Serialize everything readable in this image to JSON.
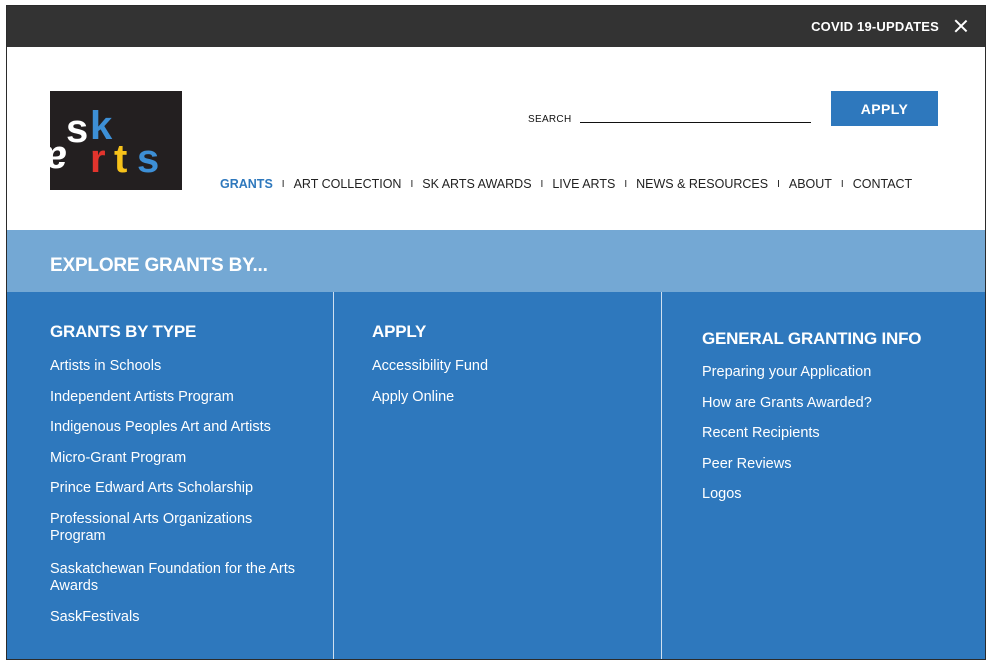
{
  "topbar": {
    "covid_label": "COVID 19-UPDATES"
  },
  "logo": {
    "row1": [
      "s",
      "k"
    ],
    "row2": [
      "a",
      "r",
      "t",
      "s"
    ],
    "colors": {
      "s1": "#ffffff",
      "k": "#3d8fd6",
      "a": "#ffffff",
      "r": "#e2342d",
      "t": "#f7c21a",
      "s2": "#3d8fd6"
    }
  },
  "search": {
    "label": "SEARCH",
    "value": "",
    "placeholder": ""
  },
  "apply_label": "APPLY",
  "nav": {
    "items": [
      {
        "label": "GRANTS",
        "active": true
      },
      {
        "label": "ART COLLECTION"
      },
      {
        "label": "SK ARTS AWARDS"
      },
      {
        "label": "LIVE ARTS"
      },
      {
        "label": "NEWS & RESOURCES"
      },
      {
        "label": "ABOUT"
      },
      {
        "label": "CONTACT"
      }
    ],
    "separator": "I"
  },
  "explore": {
    "title": "EXPLORE GRANTS BY..."
  },
  "columns": [
    {
      "heading": "GRANTS BY TYPE",
      "links": [
        "Artists in Schools",
        "Independent Artists Program",
        "Indigenous Peoples Art and Artists",
        "Micro-Grant Program",
        "Prince Edward Arts Scholarship",
        "Professional Arts Organizations Program",
        "Saskatchewan Foundation for the Arts Awards",
        "SaskFestivals"
      ]
    },
    {
      "heading": "APPLY",
      "links": [
        "Accessibility Fund",
        "Apply Online"
      ]
    },
    {
      "heading": "GENERAL GRANTING INFO",
      "links": [
        "Preparing your Application",
        "How are Grants Awarded?",
        "Recent Recipients",
        "Peer Reviews",
        "Logos"
      ]
    }
  ],
  "colors": {
    "accent": "#2e78bd",
    "band": "#74a8d4",
    "topbar": "#333333"
  }
}
